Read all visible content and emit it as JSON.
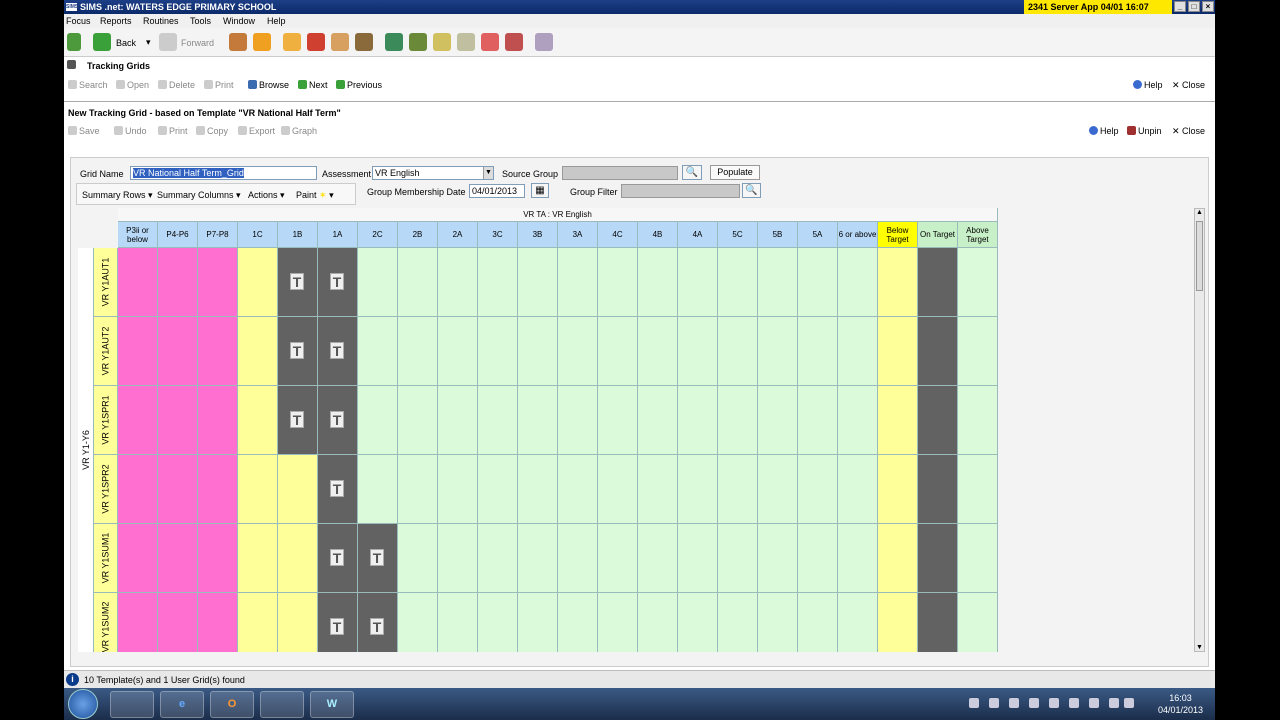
{
  "window": {
    "app_logo": "SIMS",
    "title": "SIMS .net: WATERS EDGE PRIMARY SCHOOL",
    "server_info": "2341  Server App  04/01  16:07"
  },
  "menu": [
    "Focus",
    "Reports",
    "Routines",
    "Tools",
    "Window",
    "Help"
  ],
  "main_toolbar": {
    "back": "Back",
    "forward": "Forward"
  },
  "tracking_grids": {
    "title": "Tracking Grids",
    "toolbar": [
      "Search",
      "Open",
      "Delete",
      "Print",
      "Browse",
      "Next",
      "Previous"
    ],
    "help": "Help",
    "close": "Close"
  },
  "new_grid": {
    "title": "New Tracking Grid - based on Template \"VR National Half Term\"",
    "toolbar": [
      "Save",
      "Undo",
      "Print",
      "Copy",
      "Export",
      "Graph"
    ],
    "help": "Help",
    "unpin": "Unpin",
    "close": "Close"
  },
  "form": {
    "grid_name_label": "Grid Name",
    "grid_name_value": "VR National Half Term_Grid",
    "assessment_label": "Assessment",
    "assessment_value": "VR English",
    "source_group_label": "Source Group",
    "source_group_value": "",
    "populate": "Populate",
    "summary_rows": "Summary Rows",
    "summary_columns": "Summary Columns",
    "actions": "Actions",
    "paint": "Paint",
    "membership_label": "Group Membership Date",
    "membership_value": "04/01/2013",
    "group_filter_label": "Group Filter",
    "group_filter_value": ""
  },
  "grid": {
    "super_header": "VR TA : VR English",
    "group_label": "VR Y1-Y6",
    "columns": [
      "P3ii or below",
      "P4-P6",
      "P7-P8",
      "1C",
      "1B",
      "1A",
      "2C",
      "2B",
      "2A",
      "3C",
      "3B",
      "3A",
      "4C",
      "4B",
      "4A",
      "5C",
      "5B",
      "5A",
      "6 or above",
      "Below Target",
      "On Target",
      "Above Target"
    ],
    "rows": [
      "VR Y1AUT1",
      "VR Y1AUT2",
      "VR Y1SPR1",
      "VR Y1SPR2",
      "VR Y1SUM1",
      "VR Y1SUM2"
    ],
    "target_mark": "T"
  },
  "status": {
    "info_icon": "i",
    "text": "10 Template(s) and 1 User Grid(s) found"
  },
  "taskbar": {
    "apps": [
      "folder-icon",
      "ie-icon",
      "outlook-icon",
      "sims-icon",
      "word-icon"
    ],
    "app_letters": [
      "",
      "e",
      "O",
      "",
      "W"
    ],
    "time": "16:03",
    "date": "04/01/2013"
  }
}
